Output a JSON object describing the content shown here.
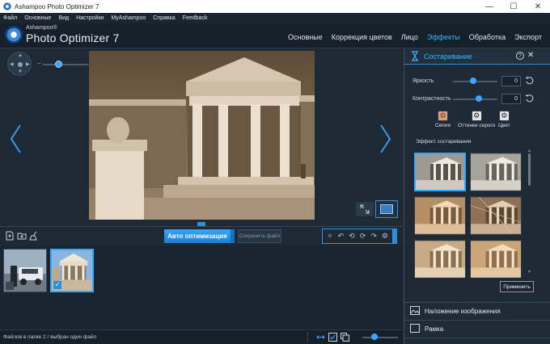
{
  "window": {
    "title": "Ashampoo Photo Optimizer 7",
    "min": "—",
    "max": "☐",
    "close": "✕"
  },
  "menu": [
    "Файл",
    "Основные",
    "Вид",
    "Настройки",
    "MyAshampoo",
    "Справка",
    "Feedback"
  ],
  "brand": {
    "small": "Ashampoo®",
    "big": "Photo Optimizer 7"
  },
  "tabs": [
    {
      "label": "Основные",
      "active": false
    },
    {
      "label": "Коррекция цветов",
      "active": false
    },
    {
      "label": "Лицо",
      "active": false
    },
    {
      "label": "Эффекты",
      "active": true
    },
    {
      "label": "Обработка",
      "active": false
    },
    {
      "label": "Экспорт",
      "active": false
    }
  ],
  "zoom": {
    "minus": "−",
    "plus": "+",
    "level": 0.33
  },
  "toolbar": {
    "auto_label": "Авто оптимизация",
    "save_label": "Сохранить файл"
  },
  "thumbnails": [
    {
      "name": "car",
      "selected": false
    },
    {
      "name": "temple",
      "selected": true,
      "check": "✓"
    }
  ],
  "status": {
    "text": "Файлов в папке 2 / выбран один файл",
    "zoom_level": 0.3
  },
  "panel": {
    "title": "Состаривание",
    "help": "?",
    "close": "✕",
    "sliders": [
      {
        "label": "Яркость",
        "value": "0",
        "position": 0.45
      },
      {
        "label": "Контрастность",
        "value": "0",
        "position": 0.58
      }
    ],
    "modes": [
      {
        "label": "Сепия"
      },
      {
        "label": "Оттенки серого"
      },
      {
        "label": "Цвет"
      }
    ],
    "effects_label": "Эффект состаривания",
    "apply_label": "Применить",
    "accordions": [
      {
        "label": "Наложение изображения"
      },
      {
        "label": "Рамка"
      }
    ]
  },
  "colors": {
    "accent": "#33b7ff",
    "bg": "#1e2a36",
    "button": "#2d8fd9"
  }
}
